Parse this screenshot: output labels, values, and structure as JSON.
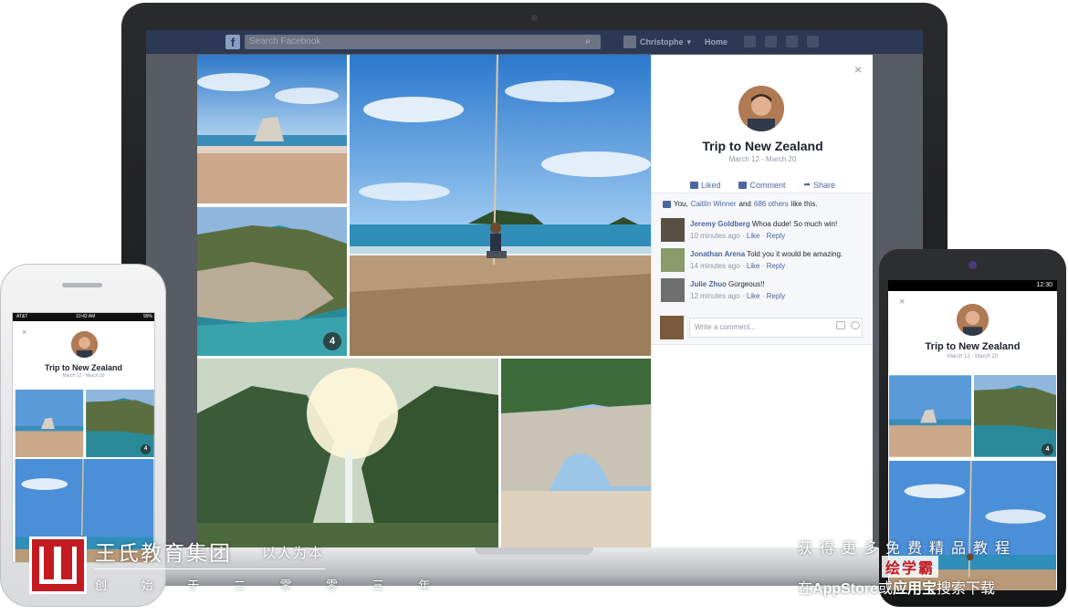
{
  "facebook": {
    "logo": "f",
    "search_placeholder": "Search Facebook",
    "user_name": "Christophe",
    "home_label": "Home"
  },
  "album": {
    "close": "×",
    "title": "Trip to New Zealand",
    "date_range": "March 12 - March 20",
    "photo_count_badge": "4",
    "actions": {
      "liked": "Liked",
      "comment": "Comment",
      "share": "Share"
    },
    "likes": {
      "you": "You,",
      "friend": "Caitlin Winner",
      "and": "and",
      "others": "686 others",
      "suffix": "like this."
    },
    "comments": [
      {
        "name": "Jeremy Goldberg",
        "text": "Whoa dude! So much win!",
        "time": "10 minutes ago",
        "like": "Like",
        "reply": "Reply"
      },
      {
        "name": "Jonathan Arena",
        "text": "Told you it would be amazing.",
        "time": "14 minutes ago",
        "like": "Like",
        "reply": "Reply"
      },
      {
        "name": "Julie Zhuo",
        "text": "Gorgeous!!",
        "time": "12 minutes ago",
        "like": "Like",
        "reply": "Reply"
      }
    ],
    "comment_placeholder": "Write a comment..."
  },
  "iphone": {
    "status_carrier": "AT&T",
    "status_time": "10:42 AM",
    "status_battery": "99%"
  },
  "android": {
    "status_time": "12:30"
  },
  "watermark": {
    "org_name": "王氏教育集团",
    "slogan": "以人为本",
    "sub": "创 始 于 二 零 零 三 年",
    "promo_line1": "获得更多免费精品教程",
    "promo_brand": "绘学霸",
    "promo_line3_prefix": "在",
    "promo_store1": "AppStore",
    "promo_or": "或",
    "promo_store2": "应用宝",
    "promo_line3_suffix": "搜索下载"
  },
  "colors": {
    "facebook_bar": "#2d3954",
    "link_blue": "#4b67a1",
    "watermark_red": "#c41a21"
  }
}
